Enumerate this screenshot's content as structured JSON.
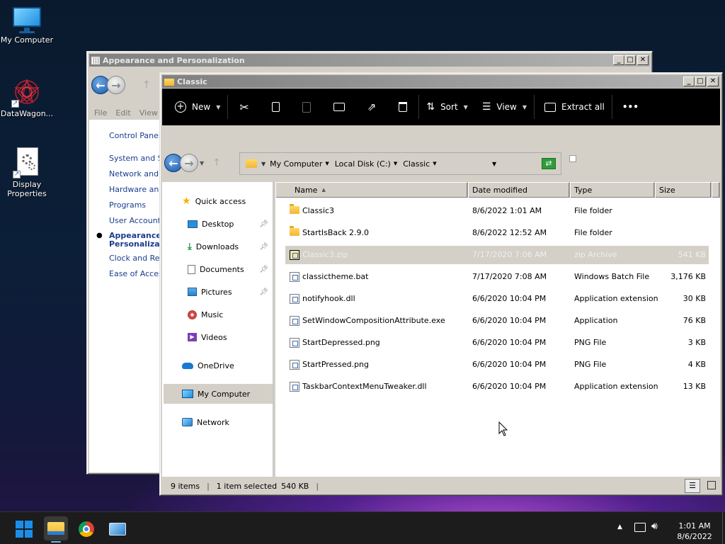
{
  "desktop": {
    "icons": [
      {
        "label": "My Computer",
        "icon": "computer-icon"
      },
      {
        "label": "DataWagon...",
        "icon": "datawagon-icon"
      },
      {
        "label": "Display Properties",
        "icon": "display-properties-icon"
      }
    ]
  },
  "back_window": {
    "title": "Appearance and Personalization",
    "menu": [
      "File",
      "Edit",
      "View"
    ],
    "links": [
      "Control Panel H",
      "System and Se",
      "Network and In",
      "Hardware and",
      "Programs",
      "User Accounts",
      "Appearance Personalizat",
      "Clock and Regi",
      "Ease of Access"
    ],
    "active_link_line1": "Appearance",
    "active_link_line2": "Personalizat"
  },
  "window": {
    "title": "Classic",
    "ribbon": {
      "new_label": "New",
      "sort_label": "Sort",
      "view_label": "View",
      "extract_label": "Extract all",
      "more_label": "•••"
    },
    "address": {
      "crumbs": [
        "My Computer",
        "Local Disk (C:)",
        "Classic"
      ]
    },
    "nav": {
      "quick_access": "Quick access",
      "desktop": "Desktop",
      "downloads": "Downloads",
      "documents": "Documents",
      "pictures": "Pictures",
      "music": "Music",
      "videos": "Videos",
      "onedrive": "OneDrive",
      "my_computer": "My Computer",
      "network": "Network"
    },
    "columns": {
      "name": "Name",
      "date": "Date modified",
      "type": "Type",
      "size": "Size"
    },
    "files": [
      {
        "name": "Classic3",
        "date": "8/6/2022 1:01 AM",
        "type": "File folder",
        "size": "",
        "icon": "folder-icon"
      },
      {
        "name": "StartIsBack 2.9.0",
        "date": "8/6/2022 12:52 AM",
        "type": "File folder",
        "size": "",
        "icon": "folder-icon"
      },
      {
        "name": "Classic3.zip",
        "date": "7/17/2020 7:06 AM",
        "type": "zip Archive",
        "size": "541 KB",
        "icon": "zip-archive-icon"
      },
      {
        "name": "classictheme.bat",
        "date": "7/17/2020 7:08 AM",
        "type": "Windows Batch File",
        "size": "3,176 KB",
        "icon": "batch-file-icon"
      },
      {
        "name": "notifyhook.dll",
        "date": "6/6/2020 10:04 PM",
        "type": "Application extension",
        "size": "30 KB",
        "icon": "dll-file-icon"
      },
      {
        "name": "SetWindowCompositionAttribute.exe",
        "date": "6/6/2020 10:04 PM",
        "type": "Application",
        "size": "76 KB",
        "icon": "exe-file-icon"
      },
      {
        "name": "StartDepressed.png",
        "date": "6/6/2020 10:04 PM",
        "type": "PNG File",
        "size": "3 KB",
        "icon": "png-file-icon"
      },
      {
        "name": "StartPressed.png",
        "date": "6/6/2020 10:04 PM",
        "type": "PNG File",
        "size": "4 KB",
        "icon": "png-file-icon"
      },
      {
        "name": "TaskbarContextMenuTweaker.dll",
        "date": "6/6/2020 10:04 PM",
        "type": "Application extension",
        "size": "13 KB",
        "icon": "dll-file-icon"
      }
    ],
    "selected_row": 2,
    "status": {
      "items": "9 items",
      "selected": "1 item selected",
      "size": "540 KB"
    }
  },
  "taskbar": {
    "time": "1:01 AM",
    "date": "8/6/2022",
    "colors": {
      "background": "#1c1c1c",
      "accent": "#1a8ee8"
    }
  }
}
